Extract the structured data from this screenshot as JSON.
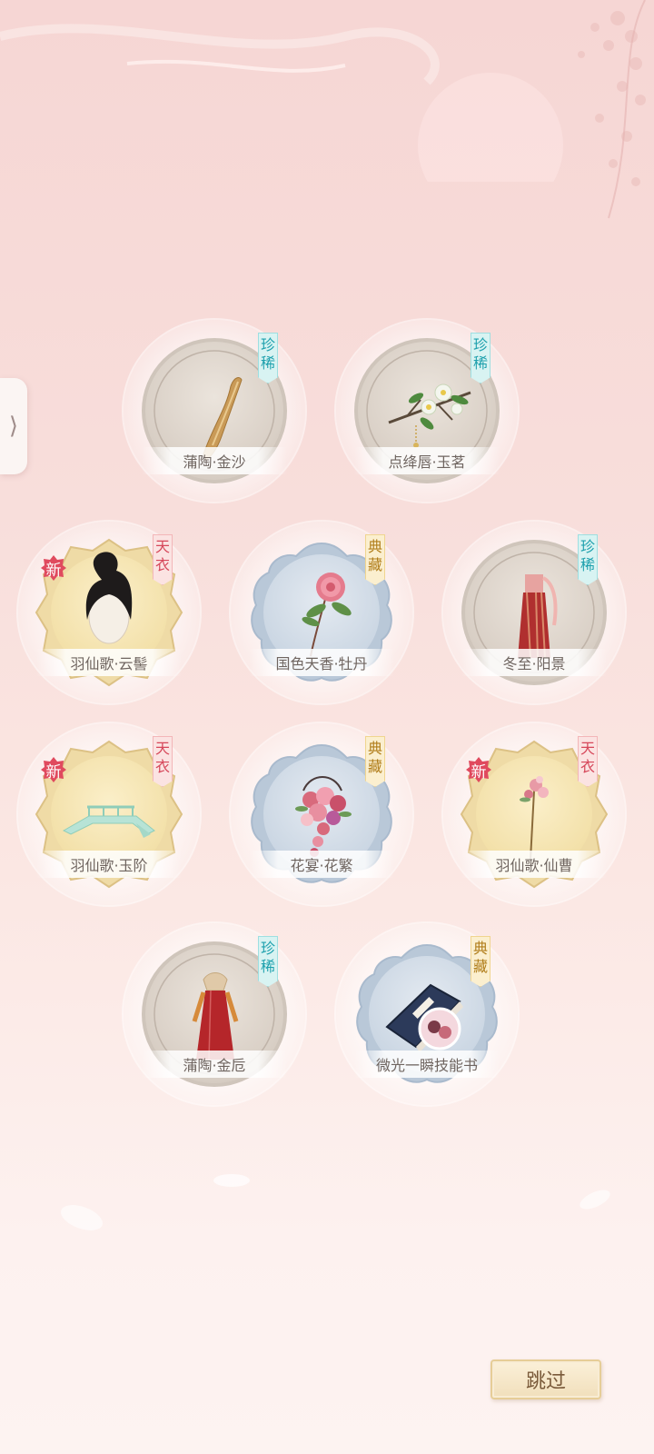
{
  "side_tab": {
    "icon": "chevron-right-icon",
    "glyph": "⟩"
  },
  "rarity_labels": {
    "rare": [
      "珍",
      "稀"
    ],
    "collection": [
      "典",
      "藏"
    ],
    "celestial": [
      "天",
      "衣"
    ]
  },
  "new_label": "新",
  "items": [
    {
      "name": "蒲陶·金沙",
      "rarity": "rare",
      "frame": "round-silver",
      "art": "hairpin-stick",
      "is_new": false
    },
    {
      "name": "点绛唇·玉茗",
      "rarity": "rare",
      "frame": "round-silver",
      "art": "flower-branch",
      "is_new": false
    },
    {
      "name": "羽仙歌·云髻",
      "rarity": "celestial",
      "frame": "lotus-gold",
      "art": "black-hair-bun",
      "is_new": true
    },
    {
      "name": "国色天香·牡丹",
      "rarity": "collection",
      "frame": "cloud-blue",
      "art": "peony-stem",
      "is_new": false
    },
    {
      "name": "冬至·阳景",
      "rarity": "rare",
      "frame": "round-silver",
      "art": "red-dress",
      "is_new": false
    },
    {
      "name": "羽仙歌·玉阶",
      "rarity": "celestial",
      "frame": "lotus-gold",
      "art": "jade-bridge",
      "is_new": true
    },
    {
      "name": "花宴·花繁",
      "rarity": "collection",
      "frame": "cloud-blue",
      "art": "flower-bouquet",
      "is_new": false
    },
    {
      "name": "羽仙歌·仙曹",
      "rarity": "celestial",
      "frame": "lotus-gold",
      "art": "flower-hairpin",
      "is_new": true
    },
    {
      "name": "蒲陶·金卮",
      "rarity": "rare",
      "frame": "round-silver",
      "art": "red-gown",
      "is_new": false
    },
    {
      "name": "微光一瞬技能书",
      "rarity": "collection",
      "frame": "cloud-blue",
      "art": "skill-book",
      "is_new": false
    }
  ],
  "skip_button": {
    "label": "跳过"
  },
  "colors": {
    "rare_tag": "#1ea0ad",
    "collection_tag": "#b07d1a",
    "celestial_tag": "#d6475a",
    "new_badge": "#e04a5e"
  }
}
